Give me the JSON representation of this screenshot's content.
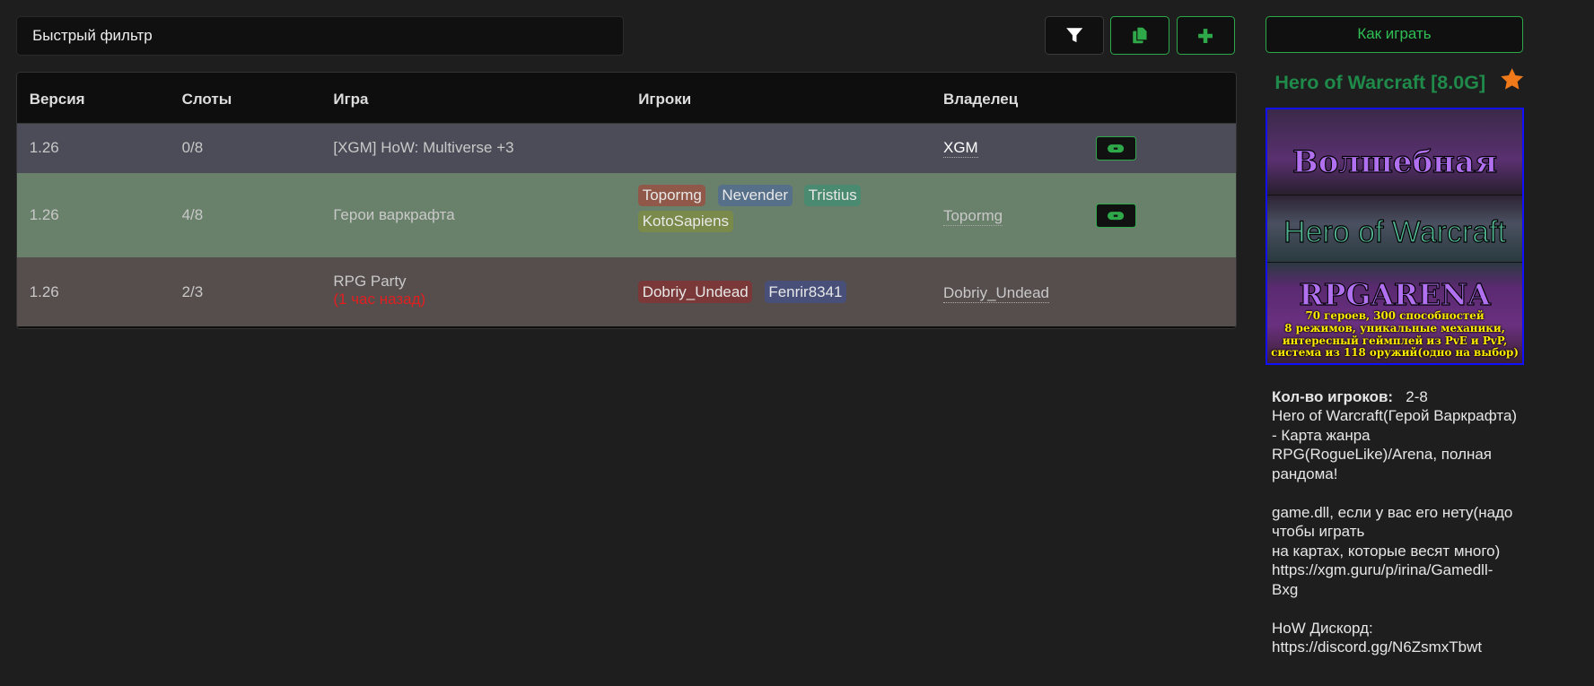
{
  "toolbar": {
    "filter_placeholder": "Быстрый фильтр",
    "filter_icon": "filter-icon",
    "copy_icon": "copy-icon",
    "add_icon": "plus-icon"
  },
  "table": {
    "headers": [
      "Версия",
      "Слоты",
      "Игра",
      "Игроки",
      "Владелец"
    ],
    "rows": [
      {
        "version": "1.26",
        "slots": "0/8",
        "game": "[XGM] HoW: Multiverse +3",
        "sub": "",
        "players": [],
        "owner": "XGM",
        "bg": "#4c4c58",
        "join": true
      },
      {
        "version": "1.26",
        "slots": "4/8",
        "game": "Герои варкрафта",
        "sub": "",
        "players": [
          {
            "name": "Topormg",
            "color": "#905848"
          },
          {
            "name": "Nevender",
            "color": "#56708a"
          },
          {
            "name": "Tristius",
            "color": "#4a8a70"
          },
          {
            "name": "KotoSapiens",
            "color": "#7a8a4a"
          }
        ],
        "owner": "Topormg",
        "bg": "#69806a",
        "join": true
      },
      {
        "version": "1.26",
        "slots": "2/3",
        "game": "RPG Party",
        "sub": "(1 час назад)",
        "players": [
          {
            "name": "Dobriy_Undead",
            "color": "#7a3838"
          },
          {
            "name": "Fenrir8341",
            "color": "#48507a"
          }
        ],
        "owner": "Dobriy_Undead",
        "bg": "#564d4d",
        "join": false
      }
    ]
  },
  "side": {
    "how_to_play": "Как играть",
    "title": "Hero of Warcraft [8.0G]",
    "star_color": "#f07a1a",
    "banner": {
      "line1": "Волшебная",
      "line2": "Hero of Warcraft",
      "line3": "RPGARENA",
      "line4": "70 героев, 300 способностей",
      "line5": "8 режимов, уникальные механики,",
      "line6": "интересный геймплей из PvE и PvP,",
      "line7": "система из 118 оружий(одно на выбор)"
    },
    "players_label": "Кол-во игроков:",
    "players_value": "2-8",
    "description": "Hero of Warcraft(Герой Варкрафта)\n- Карта жанра\nRPG(RogueLike)/Arena, полная\nрандома!\n\ngame.dll, если у вас его нету(надо\nчтобы играть\nна картах, которые весят много)\nhttps://xgm.guru/p/irina/Gamedll-\nBxg\n\nHoW Дискорд:\nhttps://discord.gg/N6ZsmxTbwt"
  },
  "colors": {
    "accent": "#2fa84a",
    "title": "#1f8a4a",
    "warning": "#e02020"
  }
}
